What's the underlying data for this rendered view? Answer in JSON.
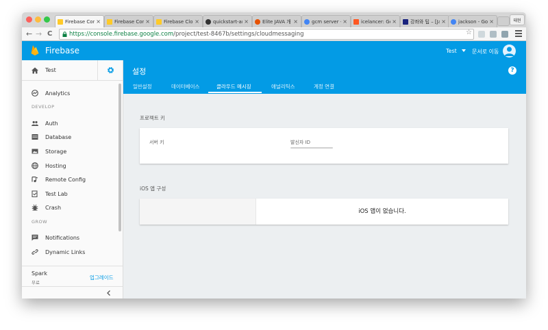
{
  "browser": {
    "tabs": [
      {
        "title": "Firebase Con",
        "favicon": "firebase-icon",
        "color": "#ffca28",
        "active": true
      },
      {
        "title": "Firebase Con",
        "favicon": "firebase-icon",
        "color": "#ffca28",
        "active": false
      },
      {
        "title": "Firebase Clou",
        "favicon": "firebase-icon",
        "color": "#ffca28",
        "active": false
      },
      {
        "title": "quickstart-an",
        "favicon": "github-icon",
        "color": "#333333",
        "active": false
      },
      {
        "title": "Elite JAVA 개",
        "favicon": "elite-java-icon",
        "color": "#e65100",
        "active": false
      },
      {
        "title": "gcm server -",
        "favicon": "google-icon",
        "color": "#4285f4",
        "active": false
      },
      {
        "title": "icelancer: Go",
        "favicon": "blogger-icon",
        "color": "#ff5722",
        "active": false
      },
      {
        "title": "강좌와 팁 – [Ja",
        "favicon": "code-icon",
        "color": "#1a237e",
        "active": false
      },
      {
        "title": "jackson - Goo",
        "favicon": "google-icon",
        "color": "#4285f4",
        "active": false
      }
    ],
    "tab_close_glyph": "×",
    "profile_label": "태현",
    "url_secure": "https://console.firebase.google.com",
    "url_path": "/project/test-8467b/settings/cloudmessaging",
    "nav_back": "←",
    "nav_forward": "→",
    "nav_reload": "C",
    "bookmark_star": "☆"
  },
  "topbar": {
    "brand": "Firebase",
    "project": "Test",
    "docs_link": "문서로 이동",
    "brand_color": "#039be5"
  },
  "sidebar": {
    "project_name": "Test",
    "analytics_label": "Analytics",
    "develop_heading": "DEVELOP",
    "develop_items": [
      {
        "label": "Auth",
        "icon": "people-icon"
      },
      {
        "label": "Database",
        "icon": "database-icon"
      },
      {
        "label": "Storage",
        "icon": "storage-icon"
      },
      {
        "label": "Hosting",
        "icon": "globe-icon"
      },
      {
        "label": "Remote Config",
        "icon": "remote-config-icon"
      },
      {
        "label": "Test Lab",
        "icon": "test-lab-icon"
      },
      {
        "label": "Crash",
        "icon": "bug-icon"
      }
    ],
    "grow_heading": "GROW",
    "grow_items": [
      {
        "label": "Notifications",
        "icon": "notifications-icon"
      },
      {
        "label": "Dynamic Links",
        "icon": "link-icon"
      }
    ],
    "plan_name": "Spark",
    "plan_tier": "무료",
    "upgrade_label": "업그레이드"
  },
  "settings": {
    "title": "설정",
    "help_glyph": "?",
    "tabs": [
      {
        "label": "일반설정",
        "active": false
      },
      {
        "label": "데이터베이스",
        "active": false
      },
      {
        "label": "클라우드 메시징",
        "active": true
      },
      {
        "label": "애널리틱스",
        "active": false
      },
      {
        "label": "계정 연결",
        "active": false
      }
    ]
  },
  "content": {
    "project_keys_heading": "프로젝트 키",
    "server_key_label": "서버 키",
    "sender_id_label": "발신자 ID",
    "ios_config_heading": "iOS 앱 구성",
    "ios_empty_message": "iOS 앱이 없습니다."
  }
}
